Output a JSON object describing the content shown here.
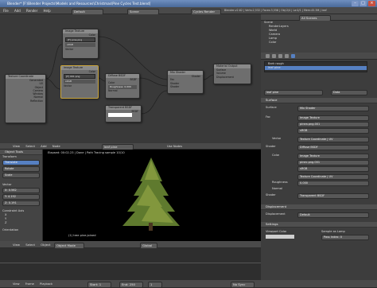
{
  "title": "Blender* [F:\\Blender Projects\\Models and Resources\\Christmas\\Pine Cycles Test.blend]",
  "main_menu": [
    "File",
    "Add",
    "Render",
    "Help"
  ],
  "header": {
    "layout": "Default",
    "scene": "Scene",
    "engine": "Cycles Render",
    "stats": "Blender-v2.62 | Verts:2,532 | Faces:3,556 | Obj:2/4 | La:0/1 | Mem:45.3M | leaf pine.joined"
  },
  "outliner": {
    "search_label": "All Scenes",
    "items": [
      "Scene",
      "RenderLayers",
      "World",
      "Camera",
      "Lamp",
      "Color"
    ]
  },
  "nodes": {
    "image_texture_1": {
      "title": "Image Texture",
      "file": "[F] pine.png",
      "mode": "sRGB",
      "socket": "Vector"
    },
    "image_texture_2": {
      "title": "Image Texture",
      "file": "[F] 001.png",
      "mode": "sRGB",
      "socket": "Vector"
    },
    "tex_coord": {
      "title": "Texture Coordinate",
      "outs": [
        "Generated",
        "UV",
        "Object",
        "Camera",
        "Window",
        "Normal",
        "Reflection"
      ]
    },
    "diffuse": {
      "title": "Diffuse BSDF",
      "ins": [
        "Color",
        "Roughness: 0.000",
        "Normal"
      ],
      "out": "BSDF"
    },
    "transparent": {
      "title": "Transparent BSDF",
      "ins": [
        "Color"
      ],
      "out": "BSDF"
    },
    "mix": {
      "title": "Mix Shader",
      "ins": [
        "Fac",
        "Shader",
        "Shader"
      ],
      "out": "Shader"
    },
    "output": {
      "title": "Material Output",
      "ins": [
        "Surface",
        "Volume",
        "Displacement"
      ]
    }
  },
  "node_header": {
    "menus": [
      "View",
      "Select",
      "Add",
      "Node"
    ],
    "material": "leaf pine",
    "use_nodes": "Use Nodes"
  },
  "viewport": {
    "status": "Elapsed: 00:02.23 | Done | Path Tracing sample 10/10",
    "label": "(1) tree pine.joined",
    "menus": [
      "View",
      "Select",
      "Object"
    ],
    "mode": "Object Mode",
    "orientation": "Global"
  },
  "npanel": {
    "header": "Object Tools",
    "transform_header": "Transform",
    "tools": [
      "Translate",
      "Rotate",
      "Scale"
    ],
    "vector_label": "Vector",
    "x": "X: 0.562",
    "y": "Y: 4.192",
    "z": "Z: 0.191",
    "constraint": "Constraint Axis",
    "axes": [
      "X",
      "Y",
      "Z"
    ],
    "orientation": "Orientation"
  },
  "properties": {
    "material_list": [
      "Bark rough",
      "leaf pine"
    ],
    "material_name": "leaf pine",
    "data_label": "Data",
    "surface_header": "Surface",
    "surface": "Surface",
    "surface_val": "Mix Shader",
    "fac": "Fac",
    "fac_val": "Image Texture",
    "fac_file": "pinea.png.001",
    "fac_mode": "sRGB",
    "vector": "Vector",
    "vector_val": "Texture Coordinate | UV",
    "shader": "Shader",
    "shader_val": "Diffuse BSDF",
    "color": "Color",
    "color_val": "Image Texture",
    "color_file": "pinec.png.001",
    "color_mode": "sRGB",
    "vector2_val": "Texture Coordinate | UV",
    "roughness": "Roughness",
    "roughness_val": "0.000",
    "normal": "Normal",
    "shader2_val": "Transparent BSDF",
    "displacement_header": "Displacement",
    "displacement": "Displacement",
    "displacement_val": "Default",
    "settings_header": "Settings",
    "viewport_color": "Viewport Color",
    "sample_lamp": "Sample as Lamp",
    "pass_index": "Pass Index: 0"
  },
  "timeline": {
    "menus": [
      "View",
      "Frame",
      "Playback"
    ],
    "start": "Start: 1",
    "end": "End: 250",
    "current": "1",
    "sync": "No Sync"
  },
  "colors": {
    "accent": "#5680c2",
    "bg": "#3a3a3a",
    "node": "#6e6e6e"
  }
}
